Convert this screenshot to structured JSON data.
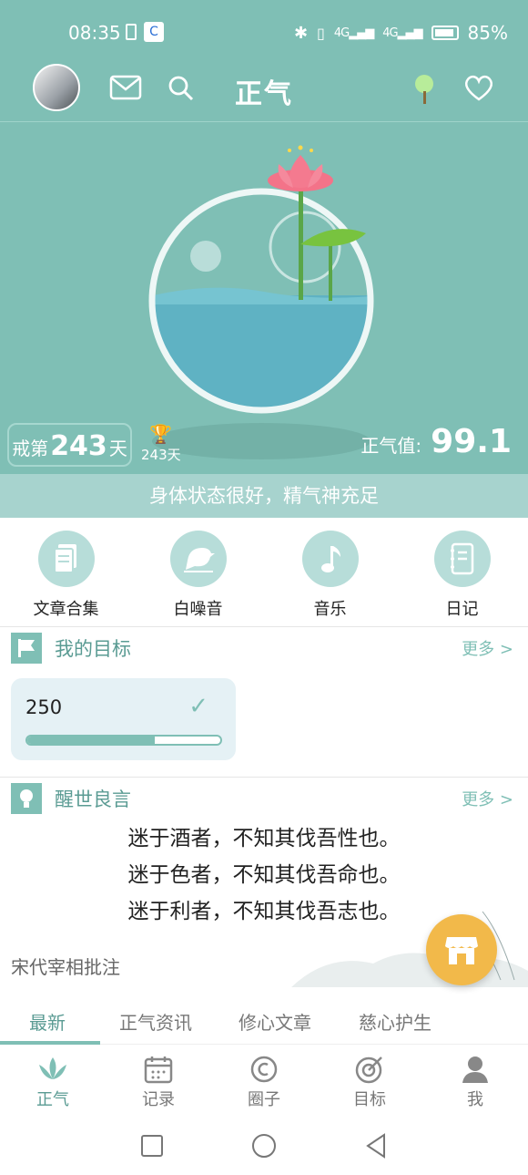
{
  "status_bar": {
    "time": "08:35",
    "battery": "85%"
  },
  "top_bar": {
    "title": "正气"
  },
  "hero": {
    "abstain_prefix": "戒第",
    "abstain_days": "243",
    "abstain_suffix": "天",
    "trophy_days": "243天",
    "score_label": "正气值:",
    "score_value": "99.1"
  },
  "status_message": "身体状态很好，精气神充足",
  "features": [
    {
      "label": "文章合集",
      "icon": "article-icon"
    },
    {
      "label": "白噪音",
      "icon": "bird-icon"
    },
    {
      "label": "音乐",
      "icon": "music-note-icon"
    },
    {
      "label": "日记",
      "icon": "diary-icon"
    }
  ],
  "goals": {
    "title": "我的目标",
    "more": "更多 >",
    "card": {
      "value": "250",
      "progress": 0.66
    }
  },
  "wisdom": {
    "title": "醒世良言",
    "more": "更多 >",
    "lines": [
      "迷于酒者，不知其伐吾性也。",
      "迷于色者，不知其伐吾命也。",
      "迷于利者，不知其伐吾志也。"
    ],
    "source": "宋代宰相批注"
  },
  "tabs": [
    "最新",
    "正气资讯",
    "修心文章",
    "慈心护生"
  ],
  "bottom_nav": [
    {
      "label": "正气",
      "icon": "lotus-icon"
    },
    {
      "label": "记录",
      "icon": "calendar-icon"
    },
    {
      "label": "圈子",
      "icon": "circle-icon"
    },
    {
      "label": "目标",
      "icon": "target-icon"
    },
    {
      "label": "我",
      "icon": "person-icon"
    }
  ],
  "colors": {
    "primary": "#7fbfb5",
    "accent": "#f2b94a",
    "lotus": "#f47a8f"
  }
}
